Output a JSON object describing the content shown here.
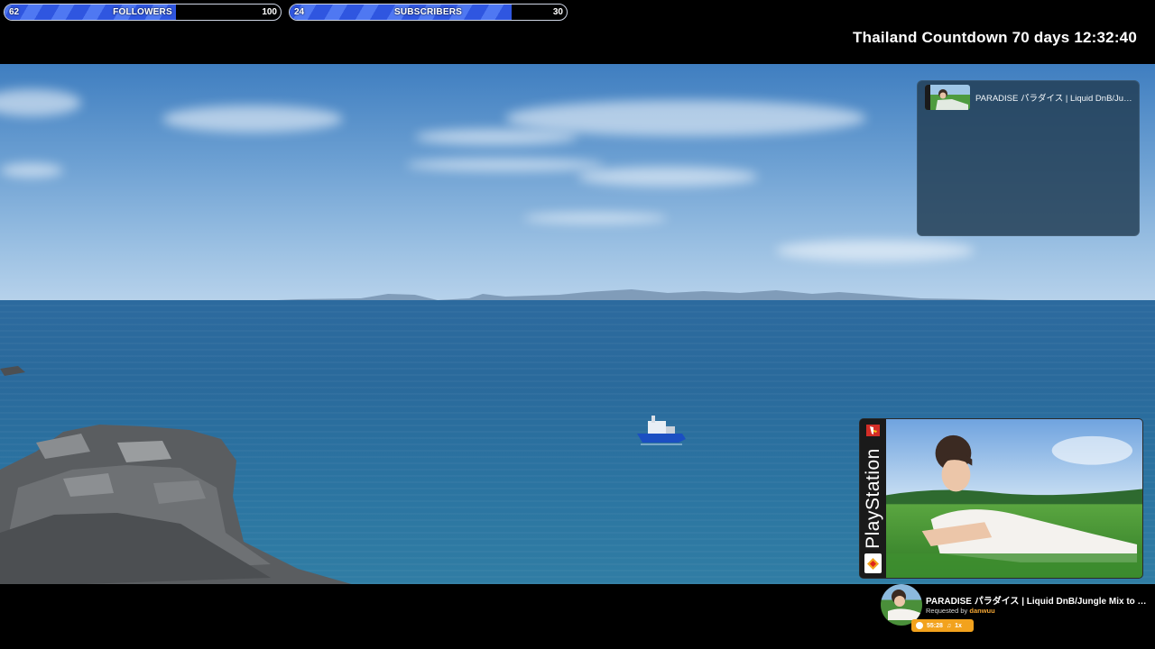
{
  "goals": {
    "followers": {
      "label": "FOLLOWERS",
      "current": "62",
      "target": "100",
      "progress": 0.62
    },
    "subscribers": {
      "label": "SUBSCRIBERS",
      "current": "24",
      "target": "30",
      "progress": 0.8
    }
  },
  "countdown": {
    "text": "Thailand Countdown 70 days 12:32:40"
  },
  "chat_panel": {
    "title": "PARADISE パラダイス | Liquid DnB/Jungle Mix to Relax/Study/Game to",
    "thumb_icon": "album-thumbnail"
  },
  "album_card": {
    "spine_text": "PlayStation",
    "logo_icon": "playstation-logo",
    "badge_icon": "sony-badge"
  },
  "now_playing": {
    "title": "PARADISE パラダイス | Liquid DnB/Jungle Mix to Relax/Study/Game to",
    "requested_prefix": "Requested by",
    "requested_user": "danwuu",
    "duration": "55:28",
    "queue": "1x",
    "accent_color": "#f2a21d"
  },
  "colors": {
    "goal_fill": "#2f56e0",
    "background": "#000000"
  }
}
